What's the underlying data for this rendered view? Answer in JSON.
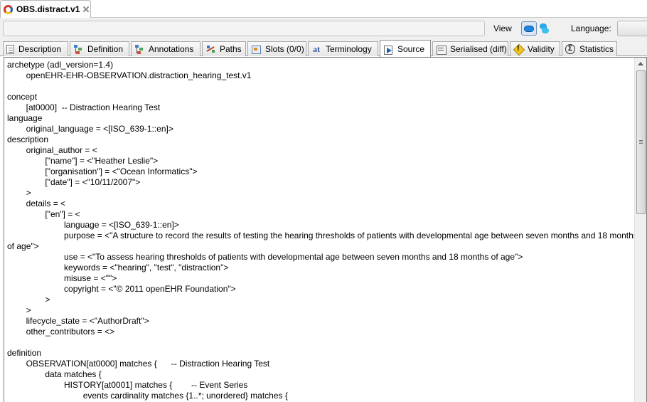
{
  "file_tab": {
    "title": "OBS.distract.v1",
    "icon": "openehr-logo-icon",
    "close_icon": "close-icon"
  },
  "toolbar": {
    "id_field_value": "",
    "view_label": "View",
    "view_buttons": [
      "cloud-view-icon",
      "leaf-view-icon"
    ],
    "language_label": "Language:",
    "language_value": ""
  },
  "tabs": [
    {
      "label": "Description",
      "icon": "description-icon"
    },
    {
      "label": "Definition",
      "icon": "tree-icon"
    },
    {
      "label": "Annotations",
      "icon": "annotations-icon"
    },
    {
      "label": "Paths",
      "icon": "paths-icon"
    },
    {
      "label": "Slots (0/0)",
      "icon": "slots-icon"
    },
    {
      "label": "Terminology",
      "icon": "terminology-icon"
    },
    {
      "label": "Source",
      "icon": "source-icon",
      "active": true
    },
    {
      "label": "Serialised (diff)",
      "icon": "serialised-icon"
    },
    {
      "label": "Validity",
      "icon": "validity-warning-icon"
    },
    {
      "label": "Statistics",
      "icon": "statistics-sigma-icon"
    }
  ],
  "source": {
    "lines": [
      "archetype (adl_version=1.4)",
      "        openEHR-EHR-OBSERVATION.distraction_hearing_test.v1",
      "",
      "concept",
      "        [at0000]  -- Distraction Hearing Test",
      "language",
      "        original_language = <[ISO_639-1::en]>",
      "description",
      "        original_author = <",
      "                [\"name\"] = <\"Heather Leslie\">",
      "                [\"organisation\"] = <\"Ocean Informatics\">",
      "                [\"date\"] = <\"10/11/2007\">",
      "        >",
      "        details = <",
      "                [\"en\"] = <",
      "                        language = <[ISO_639-1::en]>",
      "                        purpose = <\"A structure to record the results of testing the hearing thresholds of patients with developmental age between seven months and 18 months",
      "of age\">",
      "                        use = <\"To assess hearing thresholds of patients with developmental age between seven months and 18 months of age\">",
      "                        keywords = <\"hearing\", \"test\", \"distraction\">",
      "                        misuse = <\"\">",
      "                        copyright = <\"© 2011 openEHR Foundation\">",
      "                >",
      "        >",
      "        lifecycle_state = <\"AuthorDraft\">",
      "        other_contributors = <>",
      "",
      "definition",
      "        OBSERVATION[at0000] matches {      -- Distraction Hearing Test",
      "                data matches {",
      "                        HISTORY[at0001] matches {        -- Event Series",
      "                                events cardinality matches {1..*; unordered} matches {"
    ]
  }
}
